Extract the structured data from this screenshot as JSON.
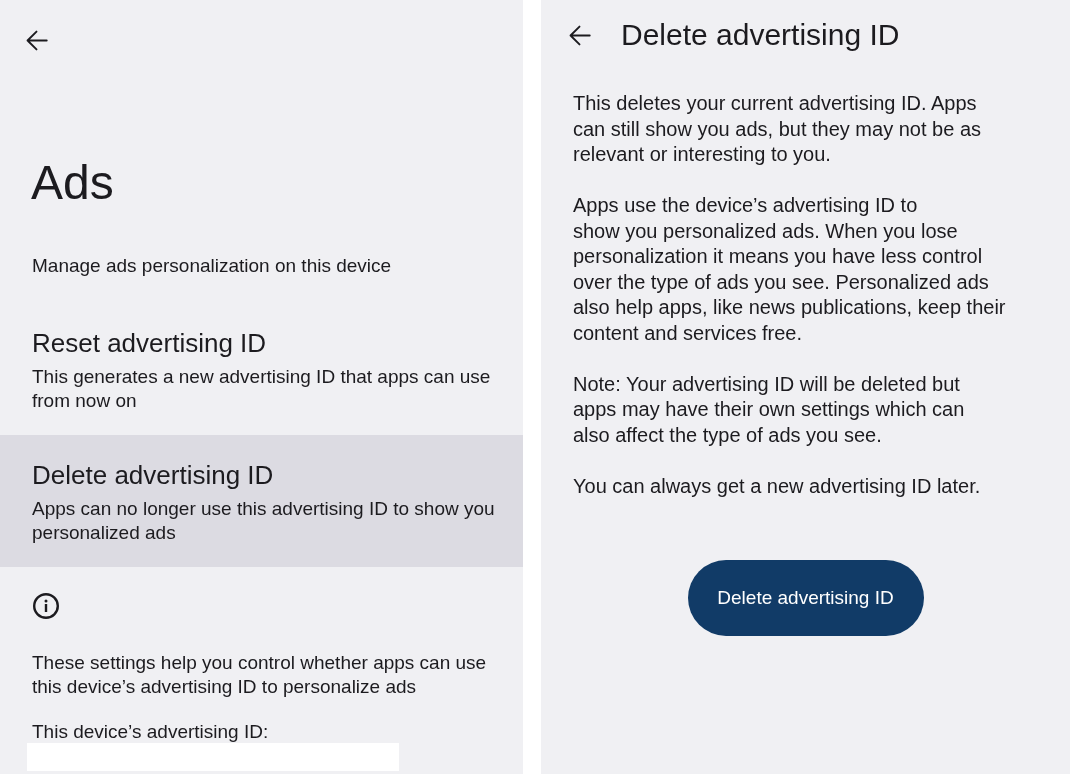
{
  "ads_screen": {
    "title": "Ads",
    "description": "Manage ads personalization on this device",
    "items": [
      {
        "title": "Reset advertising ID",
        "subtitle_lines": [
          "This generates a new advertising ID that apps can use",
          "from now on"
        ],
        "selected": false
      },
      {
        "title": "Delete advertising ID",
        "subtitle_lines": [
          "Apps can no longer use this advertising ID to show you",
          "personalized ads"
        ],
        "selected": true
      }
    ],
    "info_lines": [
      "These settings help you control whether apps can use",
      "this device’s advertising ID to personalize ads"
    ],
    "id_label": "This device’s advertising ID:"
  },
  "delete_screen": {
    "title": "Delete advertising ID",
    "paragraphs": [
      [
        "This deletes your current advertising ID. Apps",
        "can still show you ads, but they may not be as",
        "relevant or interesting to you."
      ],
      [
        "Apps use the device’s advertising ID to",
        "show you personalized ads. When you lose",
        "personalization it means you have less control",
        "over the type of ads you see. Personalized ads",
        "also help apps, like news publications, keep their",
        "content and services free."
      ],
      [
        "Note: Your advertising ID will be deleted but",
        "apps may have their own settings which can",
        "also affect the type of ads you see."
      ],
      [
        "You can always get a new advertising ID later."
      ]
    ],
    "button": "Delete advertising ID"
  }
}
